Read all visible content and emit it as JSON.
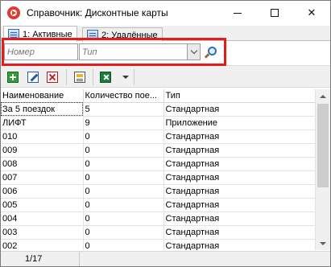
{
  "window": {
    "title": "Справочник:  Дисконтные карты"
  },
  "tabs": [
    {
      "label": "1: Активные"
    },
    {
      "label": "2: Удалённые"
    }
  ],
  "filter": {
    "number_placeholder": "Номер",
    "type_placeholder": "Тип"
  },
  "toolbar": {
    "buttons": [
      "add-icon",
      "edit-icon",
      "delete-icon",
      "properties-icon",
      "excel-export-icon",
      "dropdown-arrow-icon"
    ]
  },
  "grid": {
    "columns": [
      "Наименование",
      "Количество пое...",
      "Тип"
    ],
    "rows": [
      {
        "name": "За 5 поездок",
        "count": "5",
        "type": "Стандартная"
      },
      {
        "name": "ЛИФТ",
        "count": "9",
        "type": "Приложение"
      },
      {
        "name": "010",
        "count": "0",
        "type": "Стандартная"
      },
      {
        "name": "009",
        "count": "0",
        "type": "Стандартная"
      },
      {
        "name": "008",
        "count": "0",
        "type": "Стандартная"
      },
      {
        "name": "007",
        "count": "0",
        "type": "Стандартная"
      },
      {
        "name": "006",
        "count": "0",
        "type": "Стандартная"
      },
      {
        "name": "005",
        "count": "0",
        "type": "Стандартная"
      },
      {
        "name": "004",
        "count": "0",
        "type": "Стандартная"
      },
      {
        "name": "003",
        "count": "0",
        "type": "Стандартная"
      },
      {
        "name": "002",
        "count": "0",
        "type": "Стандартная"
      }
    ]
  },
  "status": {
    "position": "1/17"
  },
  "colors": {
    "highlight": "#e81a1a",
    "app_icon": "#e23a2e"
  }
}
